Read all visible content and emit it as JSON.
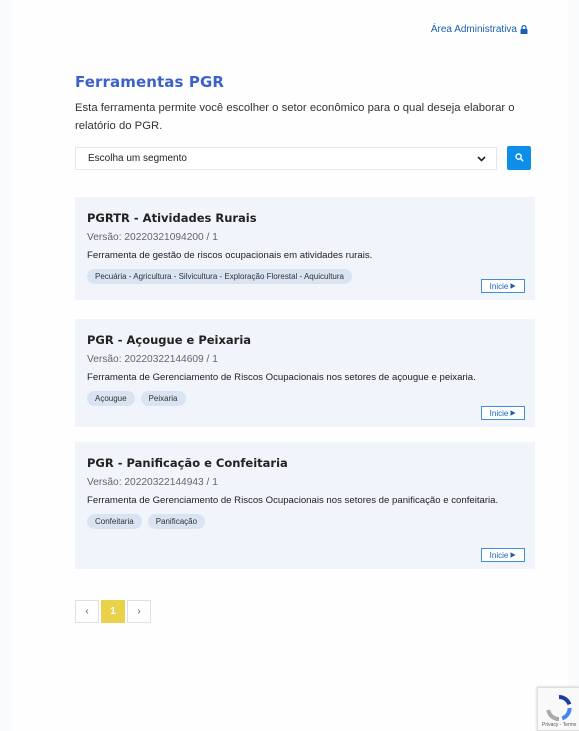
{
  "header": {
    "admin_label": "Área Administrativa"
  },
  "intro": {
    "title": "Ferramentas PGR",
    "description": "Esta ferramenta permite você escolher o setor econômico para o qual deseja elaborar o relatório do PGR."
  },
  "filter": {
    "selected": "Escolha um segmento"
  },
  "cards": [
    {
      "title": "PGRTR - Atividades Rurais",
      "version": "Versão: 20220321094200 / 1",
      "description": "Ferramenta de gestão de riscos ocupacionais em atividades rurais.",
      "tags": [
        "Pecuária - Agricultura - Silvicultura - Exploração Florestal - Aquicultura"
      ],
      "button": "Inicie"
    },
    {
      "title": "PGR - Açougue e Peixaria",
      "version": "Versão: 20220322144609 / 1",
      "description": "Ferramenta de Gerenciamento de Riscos Ocupacionais nos setores de açougue e peixaria.",
      "tags": [
        "Açougue",
        "Peixaria"
      ],
      "button": "Inicie"
    },
    {
      "title": "PGR - Panificação e Confeitaria",
      "version": "Versão: 20220322144943 / 1",
      "description": "Ferramenta de Gerenciamento de Riscos Ocupacionais nos setores de panificação e confeitaria.",
      "tags": [
        "Confeitaria",
        "Panificação"
      ],
      "button": "Inicie"
    }
  ],
  "pagination": {
    "prev": "‹",
    "current": "1",
    "next": "›"
  },
  "recaptcha": {
    "text": "Privacy - Terms"
  },
  "colors": {
    "accent": "#3c62c8",
    "button": "#0d8ee9",
    "active_page": "#e9d24a"
  },
  "icons": {
    "admin": "lock-icon",
    "search": "search-icon",
    "select": "chevron-down-icon",
    "start": "play-icon"
  }
}
